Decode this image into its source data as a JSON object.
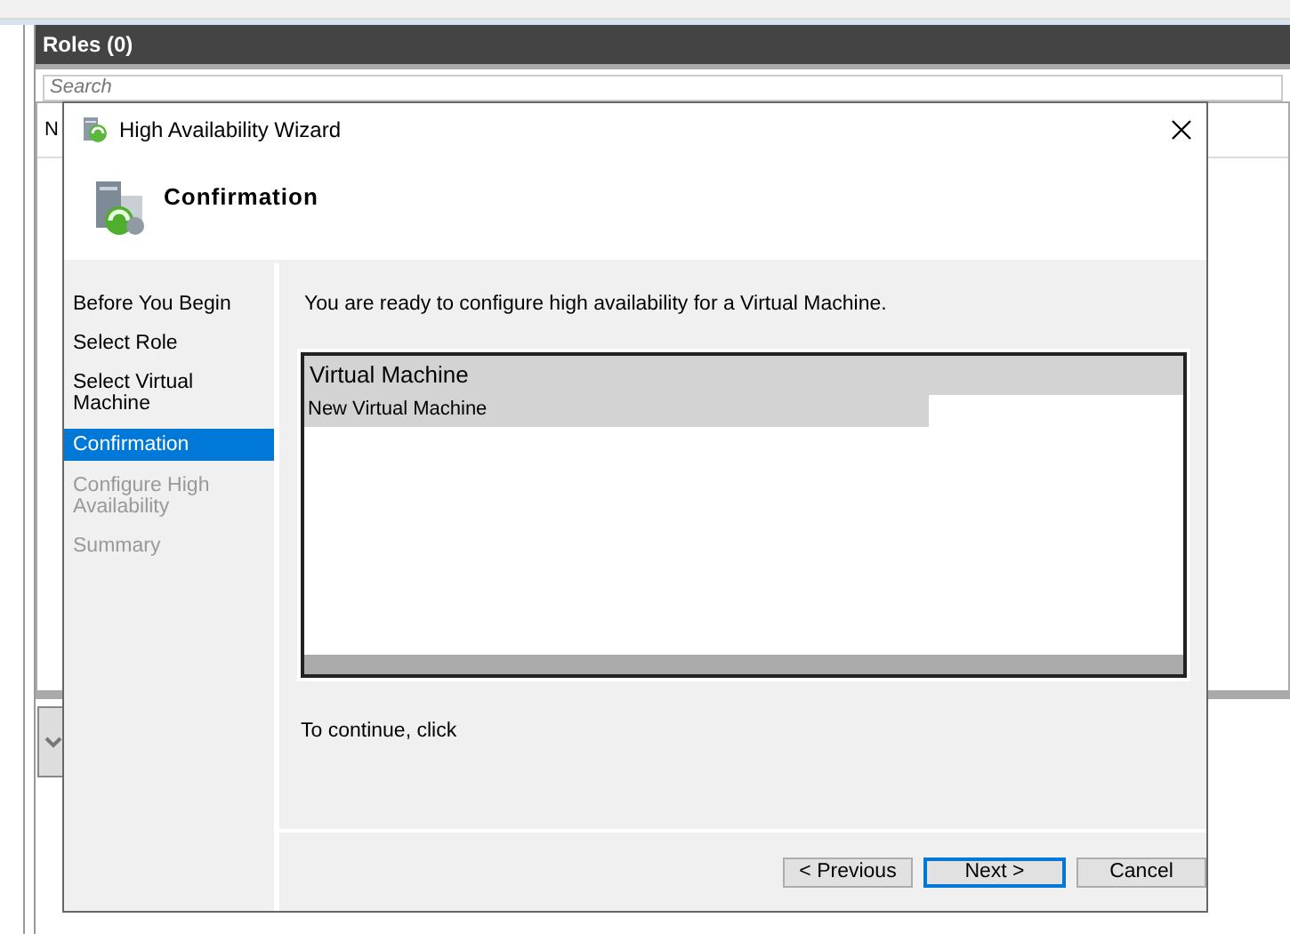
{
  "roles_panel": {
    "title": "Roles (0)",
    "search": {
      "placeholder": "Search"
    },
    "column_1": "N"
  },
  "wizard": {
    "title": "High Availability Wizard",
    "page_title": "Confirmation",
    "steps": [
      {
        "label": "Before You Begin",
        "selected": false,
        "disabled": false
      },
      {
        "label": "Select Role",
        "selected": false,
        "disabled": false
      },
      {
        "label": "Select Virtual Machine",
        "selected": false,
        "disabled": false
      },
      {
        "label": "Confirmation",
        "selected": true,
        "disabled": false
      },
      {
        "label": "Configure High Availability",
        "selected": false,
        "disabled": true
      },
      {
        "label": "Summary",
        "selected": false,
        "disabled": true
      }
    ],
    "message": "You are ready to configure high availability for a Virtual Machine.",
    "list": {
      "heading": "Virtual Machine",
      "rows": [
        {
          "label": "New Virtual Machine",
          "selected": true
        }
      ]
    },
    "continue_text": "To continue, click",
    "buttons": [
      {
        "label": "< Previous",
        "default": false
      },
      {
        "label": "Next >",
        "default": true
      },
      {
        "label": "Cancel",
        "default": false
      }
    ]
  }
}
